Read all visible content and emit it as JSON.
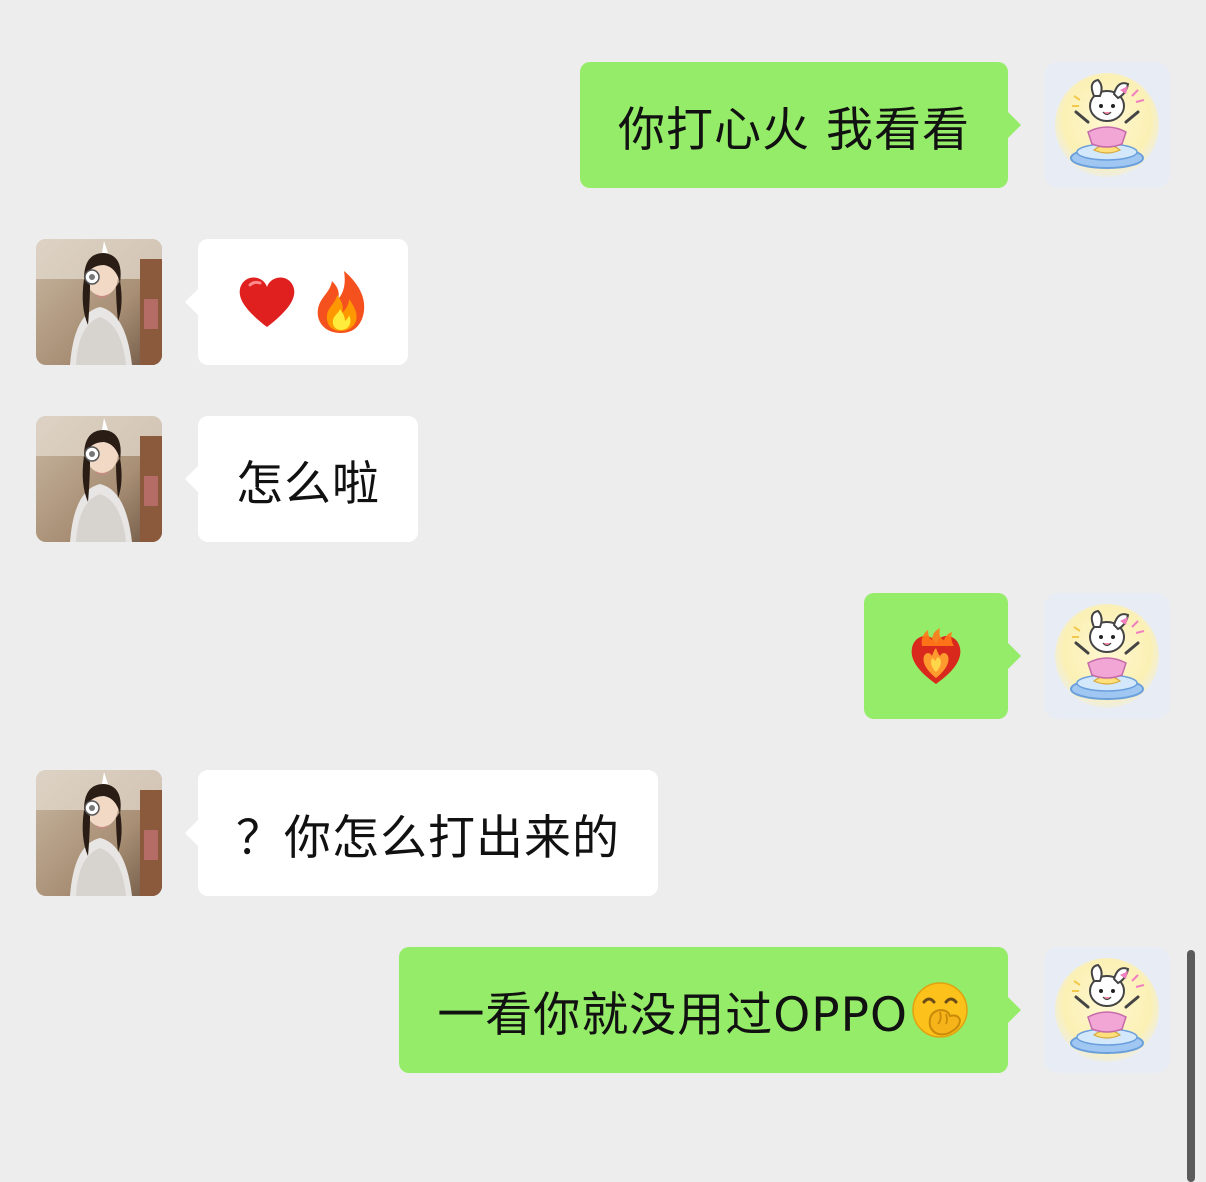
{
  "messages": [
    {
      "direction": "out",
      "text": "你打心火 我看看"
    },
    {
      "direction": "in",
      "emojis": [
        "red-heart-icon",
        "fire-icon"
      ]
    },
    {
      "direction": "in",
      "text": "怎么啦"
    },
    {
      "direction": "out",
      "emojis": [
        "heart-on-fire-icon"
      ]
    },
    {
      "direction": "in",
      "text": "？你怎么打出来的"
    },
    {
      "direction": "out",
      "text": "一看你就没用过OPPO",
      "trailing_emoji": "hand-over-mouth-face-icon"
    }
  ],
  "avatars": {
    "contact": "girl-photo-avatar",
    "self": "pink-bunny-cartoon-avatar"
  },
  "colors": {
    "background": "#ededed",
    "incoming_bubble": "#ffffff",
    "outgoing_bubble": "#95ec69",
    "text": "#111111"
  }
}
